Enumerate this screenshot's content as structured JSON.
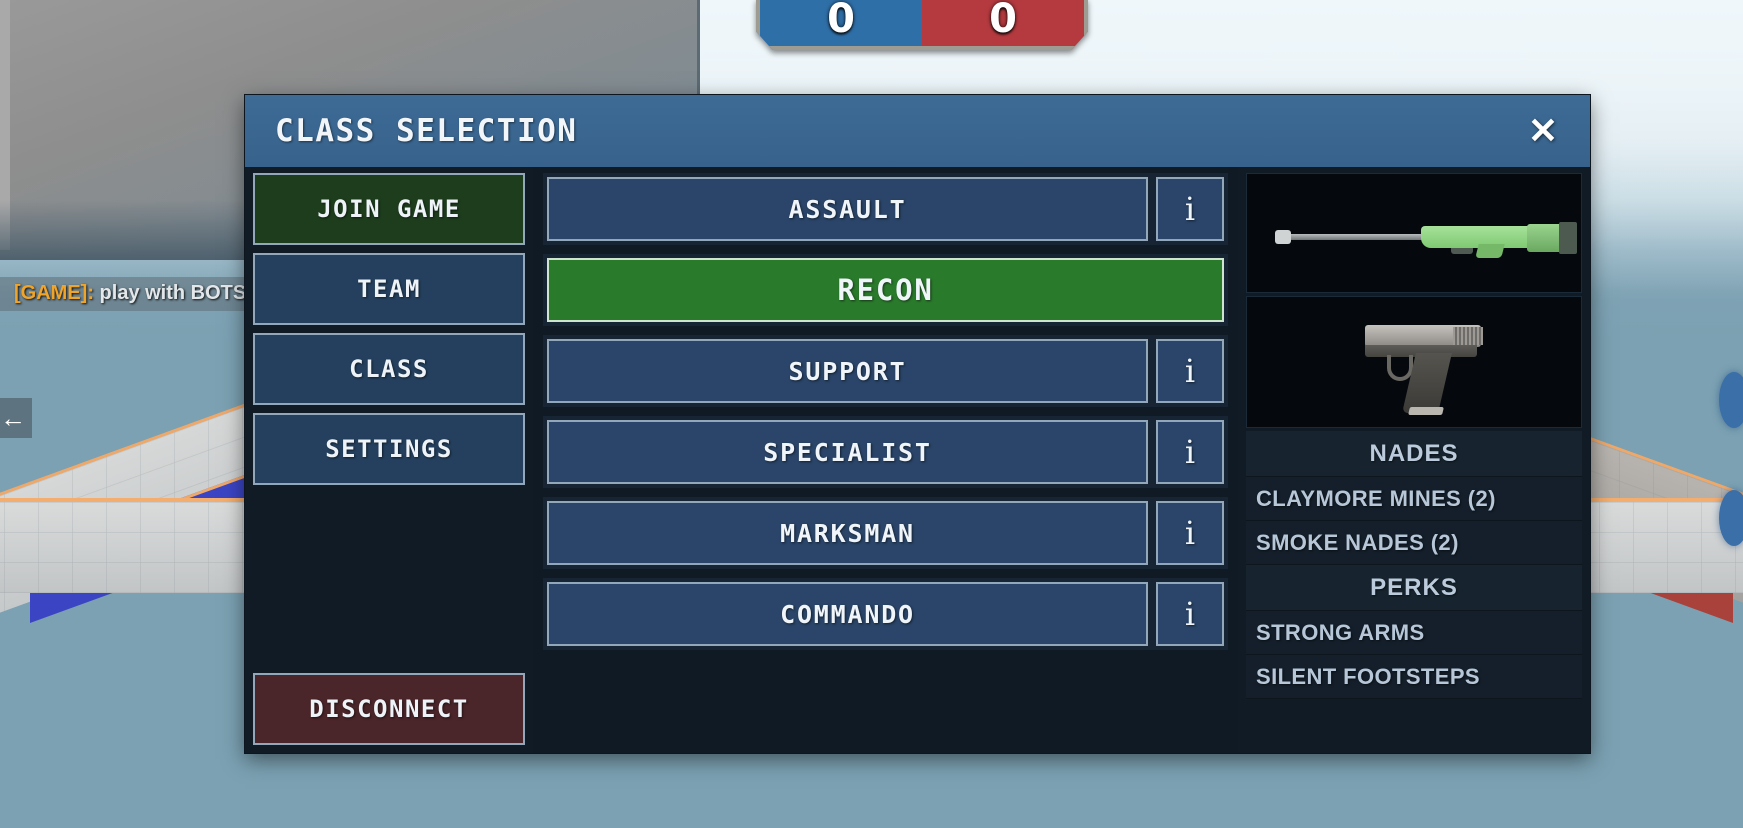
{
  "scene": {
    "scoreboard": {
      "blue_score": "0",
      "red_score": "0"
    },
    "chat": {
      "tag": "[GAME]:",
      "message": " play with BOTS"
    },
    "back_arrow": "←"
  },
  "modal": {
    "title": "CLASS SELECTION",
    "close_label": "✕",
    "nav": {
      "items": [
        {
          "label": "JOIN GAME",
          "style": "join"
        },
        {
          "label": "TEAM",
          "style": "default"
        },
        {
          "label": "CLASS",
          "style": "default"
        },
        {
          "label": "SETTINGS",
          "style": "default"
        }
      ],
      "disconnect_label": "DISCONNECT"
    },
    "classes": {
      "info_label": "i",
      "items": [
        {
          "label": "ASSAULT",
          "selected": false,
          "has_info": true
        },
        {
          "label": "RECON",
          "selected": true,
          "has_info": false
        },
        {
          "label": "SUPPORT",
          "selected": false,
          "has_info": true
        },
        {
          "label": "SPECIALIST",
          "selected": false,
          "has_info": true
        },
        {
          "label": "MARKSMAN",
          "selected": false,
          "has_info": true
        },
        {
          "label": "COMMANDO",
          "selected": false,
          "has_info": true
        }
      ]
    },
    "loadout": {
      "primary_weapon": "sniper-rifle-green",
      "secondary_weapon": "pistol",
      "nades_header": "NADES",
      "nades": [
        "CLAYMORE MINES (2)",
        "SMOKE NADES (2)"
      ],
      "perks_header": "PERKS",
      "perks": [
        "STRONG ARMS",
        "SILENT FOOTSTEPS"
      ]
    }
  },
  "colors": {
    "accent_blue": "#3d6b96",
    "selected_green": "#2a7a2c",
    "join_green": "#1d3d1d",
    "disconnect_red": "#4a2529",
    "panel_dark": "#111b26",
    "button_blue": "#2a4569",
    "chat_tag_orange": "#f0a42a",
    "score_blue": "#2f6fa8",
    "score_red": "#b43a3f"
  }
}
